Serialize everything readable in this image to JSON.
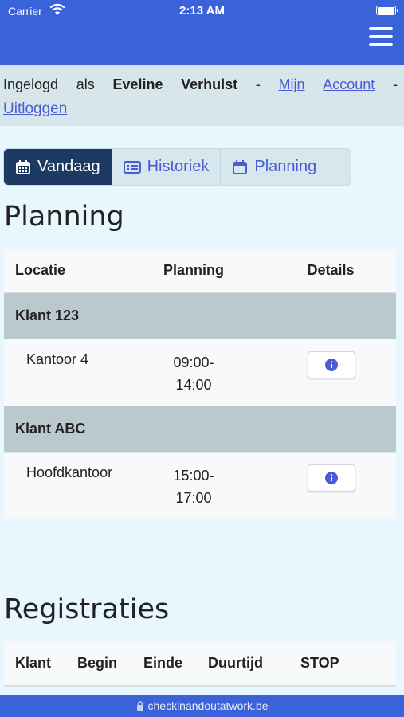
{
  "status": {
    "carrier": "Carrier",
    "time": "2:13 AM"
  },
  "login": {
    "prefix": "Ingelogd",
    "als": "als",
    "first": "Eveline",
    "last": "Verhulst",
    "dash1": "-",
    "account_1": "Mijn",
    "account_2": "Account",
    "dash2": "-",
    "logout": "Uitloggen"
  },
  "tabs": [
    {
      "label": "Vandaag",
      "icon": "calendar-icon",
      "active": true
    },
    {
      "label": "Historiek",
      "icon": "list-icon",
      "active": false
    },
    {
      "label": "Planning",
      "icon": "calendar-outline-icon",
      "active": false
    }
  ],
  "planning": {
    "title": "Planning",
    "headers": {
      "location": "Locatie",
      "planning": "Planning",
      "details": "Details"
    },
    "groups": [
      {
        "client": "Klant 123",
        "rows": [
          {
            "location": "Kantoor 4",
            "start": "09:00-",
            "end": "14:00"
          }
        ]
      },
      {
        "client": "Klant ABC",
        "rows": [
          {
            "location": "Hoofdkantoor",
            "start": "15:00-",
            "end": "17:00"
          }
        ]
      }
    ]
  },
  "registraties": {
    "title": "Registraties",
    "headers": {
      "client": "Klant",
      "begin": "Begin",
      "end": "Einde",
      "duration": "Duurtijd",
      "stop": "STOP"
    }
  },
  "url": "checkinandoutatwork.be",
  "colors": {
    "nav": "#3b63d9",
    "tab_active": "#1d3a63",
    "link": "#4a5bd6",
    "group": "#b9c9ce"
  }
}
